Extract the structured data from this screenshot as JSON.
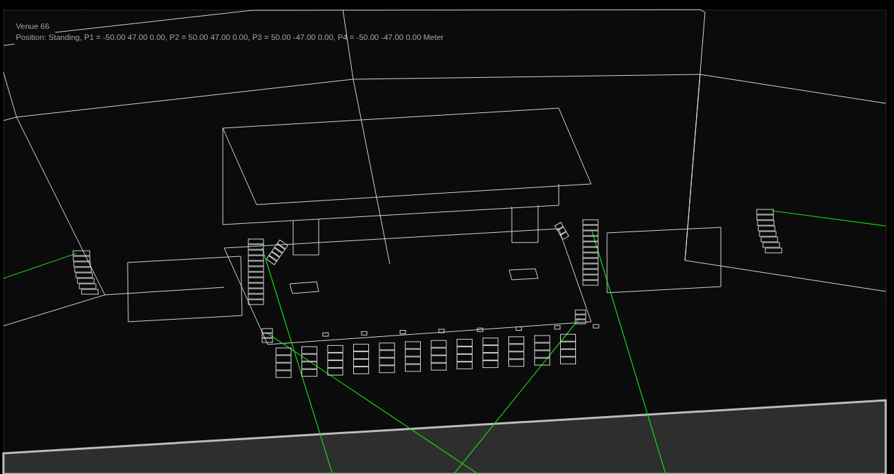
{
  "viewport": {
    "title": "Venue 66",
    "position_info": "Position: Standing, P1 = -50.00 47.00 0.00, P2 = 50.00 47.00 0.00, P3 = 50.00 -47.00 0.00, P4 = -50.00 -47.00 0.00 Meter"
  }
}
